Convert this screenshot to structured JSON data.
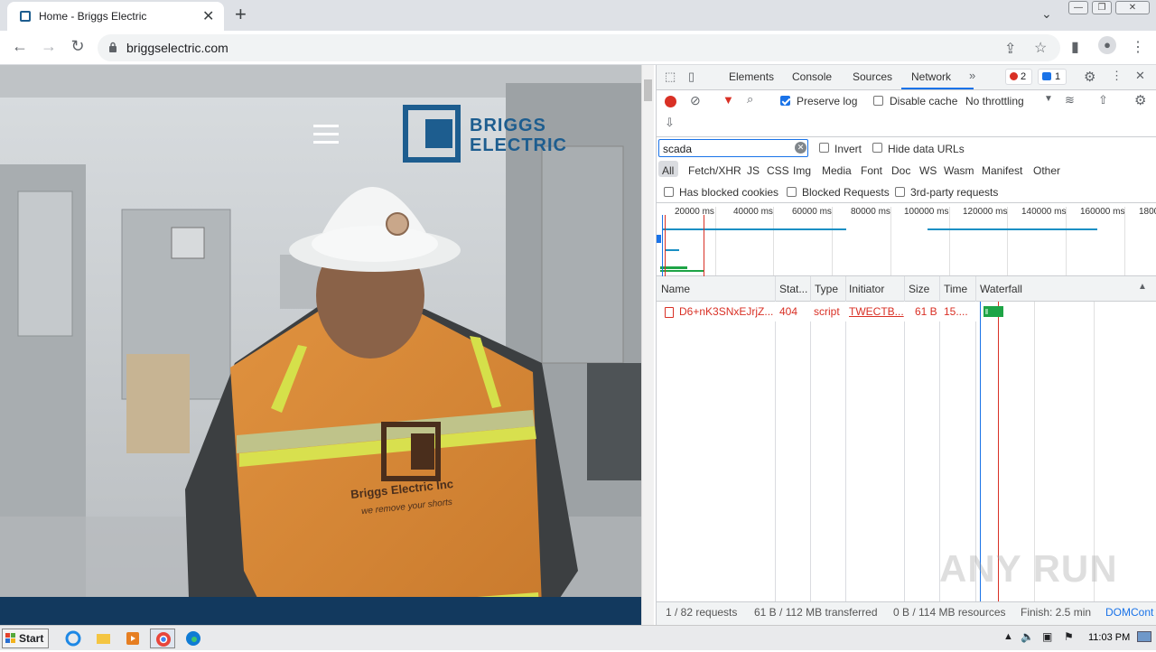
{
  "browser": {
    "tab_title": "Home - Briggs Electric",
    "url": "briggselectric.com"
  },
  "page": {
    "logo_text_line1": "BRIGGS",
    "logo_text_line2": "ELECTRIC",
    "vest_text": "Briggs Electric Inc",
    "vest_slogan": "we remove your shorts"
  },
  "devtools": {
    "tabs": [
      "Elements",
      "Console",
      "Sources",
      "Network"
    ],
    "active_tab": "Network",
    "error_count": "2",
    "message_count": "1",
    "preserve_log_label": "Preserve log",
    "preserve_log_checked": true,
    "disable_cache_label": "Disable cache",
    "throttling": "No throttling",
    "filter_value": "scada",
    "invert_label": "Invert",
    "hide_data_urls_label": "Hide data URLs",
    "type_filters": [
      "All",
      "Fetch/XHR",
      "JS",
      "CSS",
      "Img",
      "Media",
      "Font",
      "Doc",
      "WS",
      "Wasm",
      "Manifest",
      "Other"
    ],
    "has_blocked_cookies_label": "Has blocked cookies",
    "blocked_requests_label": "Blocked Requests",
    "third_party_label": "3rd-party requests",
    "overview_ticks": [
      "20000 ms",
      "40000 ms",
      "60000 ms",
      "80000 ms",
      "100000 ms",
      "120000 ms",
      "140000 ms",
      "160000 ms",
      "1800"
    ],
    "columns": [
      "Name",
      "Stat...",
      "Type",
      "Initiator",
      "Size",
      "Time",
      "Waterfall"
    ],
    "rows": [
      {
        "name": "D6+nK3SNxEJrjZ...",
        "status": "404",
        "type": "script",
        "initiator": "TWECTB...",
        "size": "61 B",
        "time": "15...."
      }
    ],
    "status_bar": {
      "requests": "1 / 82 requests",
      "transferred": "61 B / 112 MB transferred",
      "resources": "0 B / 114 MB resources",
      "finish": "Finish: 2.5 min",
      "domcontent": "DOMCont"
    }
  },
  "taskbar": {
    "start_label": "Start",
    "clock": "11:03 PM"
  },
  "watermark": "ANY RUN",
  "colors": {
    "accent": "#1a73e8",
    "error": "#d93025",
    "brand_blue": "#1d5d8f"
  }
}
